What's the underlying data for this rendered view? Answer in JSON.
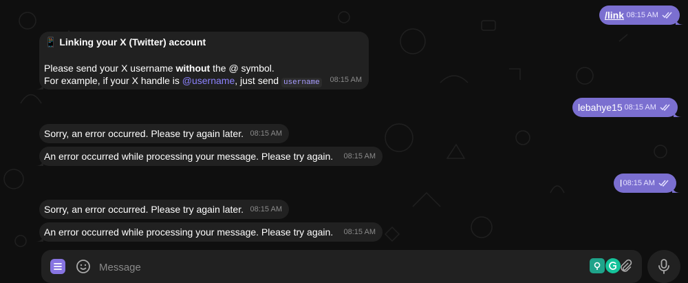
{
  "messages": {
    "out_link": {
      "text": "/link",
      "time": "08:15 AM"
    },
    "bot_link": {
      "emoji": "📱",
      "title": "Linking your X (Twitter) account",
      "line1_pre": "Please send your X username ",
      "line1_bold": "without",
      "line1_post": " the @ symbol.",
      "line2_pre": "For example, if your X handle is ",
      "line2_mention": "@username",
      "line2_mid": ", just send ",
      "line2_code": "username",
      "time": "08:15 AM"
    },
    "out_username": {
      "text": "lebahye15",
      "time": "08:15 AM"
    },
    "err1": {
      "text": "Sorry, an error occurred. Please try again later.",
      "time": "08:15 AM"
    },
    "err2": {
      "text": "An error occurred while processing your message. Please try again.",
      "time": "08:15 AM"
    },
    "out_l": {
      "text": "l",
      "time": "08:15 AM"
    },
    "err3": {
      "text": "Sorry, an error occurred. Please try again later.",
      "time": "08:15 AM"
    },
    "err4": {
      "text": "An error occurred while processing your message. Please try again.",
      "time": "08:15 AM"
    }
  },
  "composer": {
    "placeholder": "Message",
    "value": ""
  },
  "icons": {
    "menu": "menu-icon",
    "emoji": "smile-icon",
    "extension_1": "grammar-extension-icon",
    "extension_2": "grammarly-icon",
    "attach": "paperclip-icon",
    "mic": "microphone-icon",
    "read": "double-check-icon"
  },
  "colors": {
    "outgoing_bubble": "#7b6fd0",
    "incoming_bubble": "#212121",
    "accent": "#8774e1",
    "background": "#0f0f0f"
  }
}
